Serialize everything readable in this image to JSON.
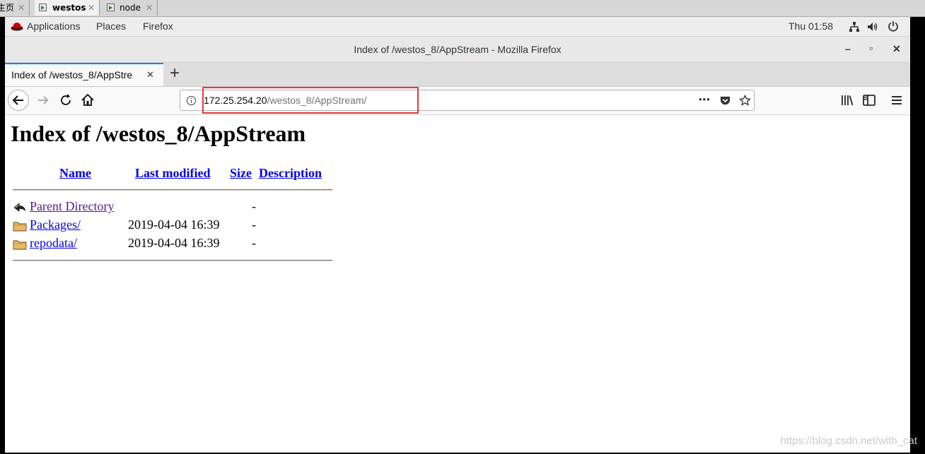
{
  "vm_tabs": [
    {
      "label": "主页",
      "active": false
    },
    {
      "label": "westos",
      "active": true
    },
    {
      "label": "node",
      "active": false
    }
  ],
  "gnome": {
    "menu_items": [
      "Applications",
      "Places",
      "Firefox"
    ],
    "clock": "Thu 01:58"
  },
  "window": {
    "title": "Index of /westos_8/AppStream - Mozilla Firefox",
    "minimize": "–",
    "maximize": "▫",
    "close": "✕"
  },
  "browser": {
    "tab_title": "Index of /westos_8/AppStre",
    "tab_close": "✕",
    "new_tab": "+",
    "url_host": "172.25.254.20",
    "url_path": "/westos_8/AppStream/",
    "page_actions": "•••"
  },
  "page": {
    "heading": "Index of /westos_8/AppStream",
    "columns": {
      "name": "Name",
      "last_modified": "Last modified",
      "size": "Size",
      "description": "Description"
    },
    "entries": [
      {
        "name": "Parent Directory",
        "modified": "",
        "size": "-",
        "visited": true,
        "icon": "back-arrow-icon"
      },
      {
        "name": "Packages/",
        "modified": "2019-04-04 16:39",
        "size": "-",
        "visited": false,
        "icon": "folder-icon"
      },
      {
        "name": "repodata/",
        "modified": "2019-04-04 16:39",
        "size": "-",
        "visited": false,
        "icon": "folder-icon"
      }
    ]
  },
  "watermark": "https://blog.csdn.net/with_cat",
  "colors": {
    "link": "#0000ee",
    "visited": "#551a8b",
    "highlight": "#e53935",
    "accent": "#0a84ff"
  }
}
